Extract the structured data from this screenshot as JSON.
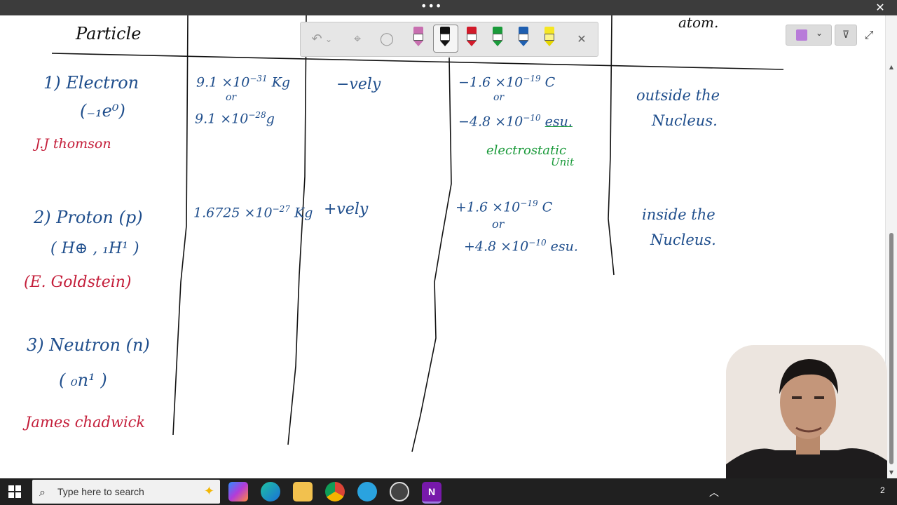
{
  "window": {
    "more_icon": "•••",
    "close_icon": "✕"
  },
  "toolbar": {
    "undo_icon": "↶",
    "undo_chevron": "⌄",
    "select_icon": "⌖",
    "lasso_icon": "◯",
    "close_icon": "✕"
  },
  "notebook": {
    "chevron": "⌄",
    "filter_icon": "⊽",
    "expand_icon": "⤢"
  },
  "notes": {
    "header_particle": "Particle",
    "header_atom": "atom.",
    "electron": {
      "name": "1) Electron",
      "symbol": "(₋₁e⁰)",
      "discoverer": "J.J thomson",
      "mass1": "9.1 ×10",
      "mass1_exp": "−31",
      "mass1_unit": "Kg",
      "or1": "or",
      "mass2": "9.1 ×10",
      "mass2_exp": "−28",
      "mass2_unit": "g",
      "nature": "−vely",
      "charge1": "−1.6 ×10",
      "charge1_exp": "−19",
      "charge1_unit": "C",
      "or2": "or",
      "charge2": "−4.8 ×10",
      "charge2_exp": "−10",
      "charge2_unit": "esu.",
      "esu_note1": "electrostatic",
      "esu_note2": "Unit",
      "location1": "outside the",
      "location2": "Nucleus."
    },
    "proton": {
      "name": "2) Proton (p)",
      "symbol": "( H⊕ ,  ₁H¹ )",
      "discoverer": "(E. Goldstein)",
      "mass": "1.6725 ×10",
      "mass_exp": "−27",
      "mass_unit": "Kg",
      "nature": "+vely",
      "charge1": "+1.6 ×10",
      "charge1_exp": "−19",
      "charge1_unit": "C",
      "or": "or",
      "charge2": "+4.8 ×10",
      "charge2_exp": "−10",
      "charge2_unit": "esu.",
      "location1": "inside the",
      "location2": "Nucleus."
    },
    "neutron": {
      "name": "3) Neutron (n)",
      "symbol": "( ₀n¹ )",
      "discoverer": "James chadwick"
    }
  },
  "taskbar": {
    "search_placeholder": "Type here to search",
    "apps": [
      "copilot",
      "edge",
      "file-explorer",
      "chrome",
      "telegram",
      "screen-recorder",
      "onenote"
    ],
    "onenote_label": "N",
    "badge": "2"
  },
  "colors": {
    "ink_blue": "#1f4e8c",
    "ink_red": "#c41e3a",
    "ink_green": "#1a9a3a",
    "onenote_purple": "#7719aa"
  }
}
